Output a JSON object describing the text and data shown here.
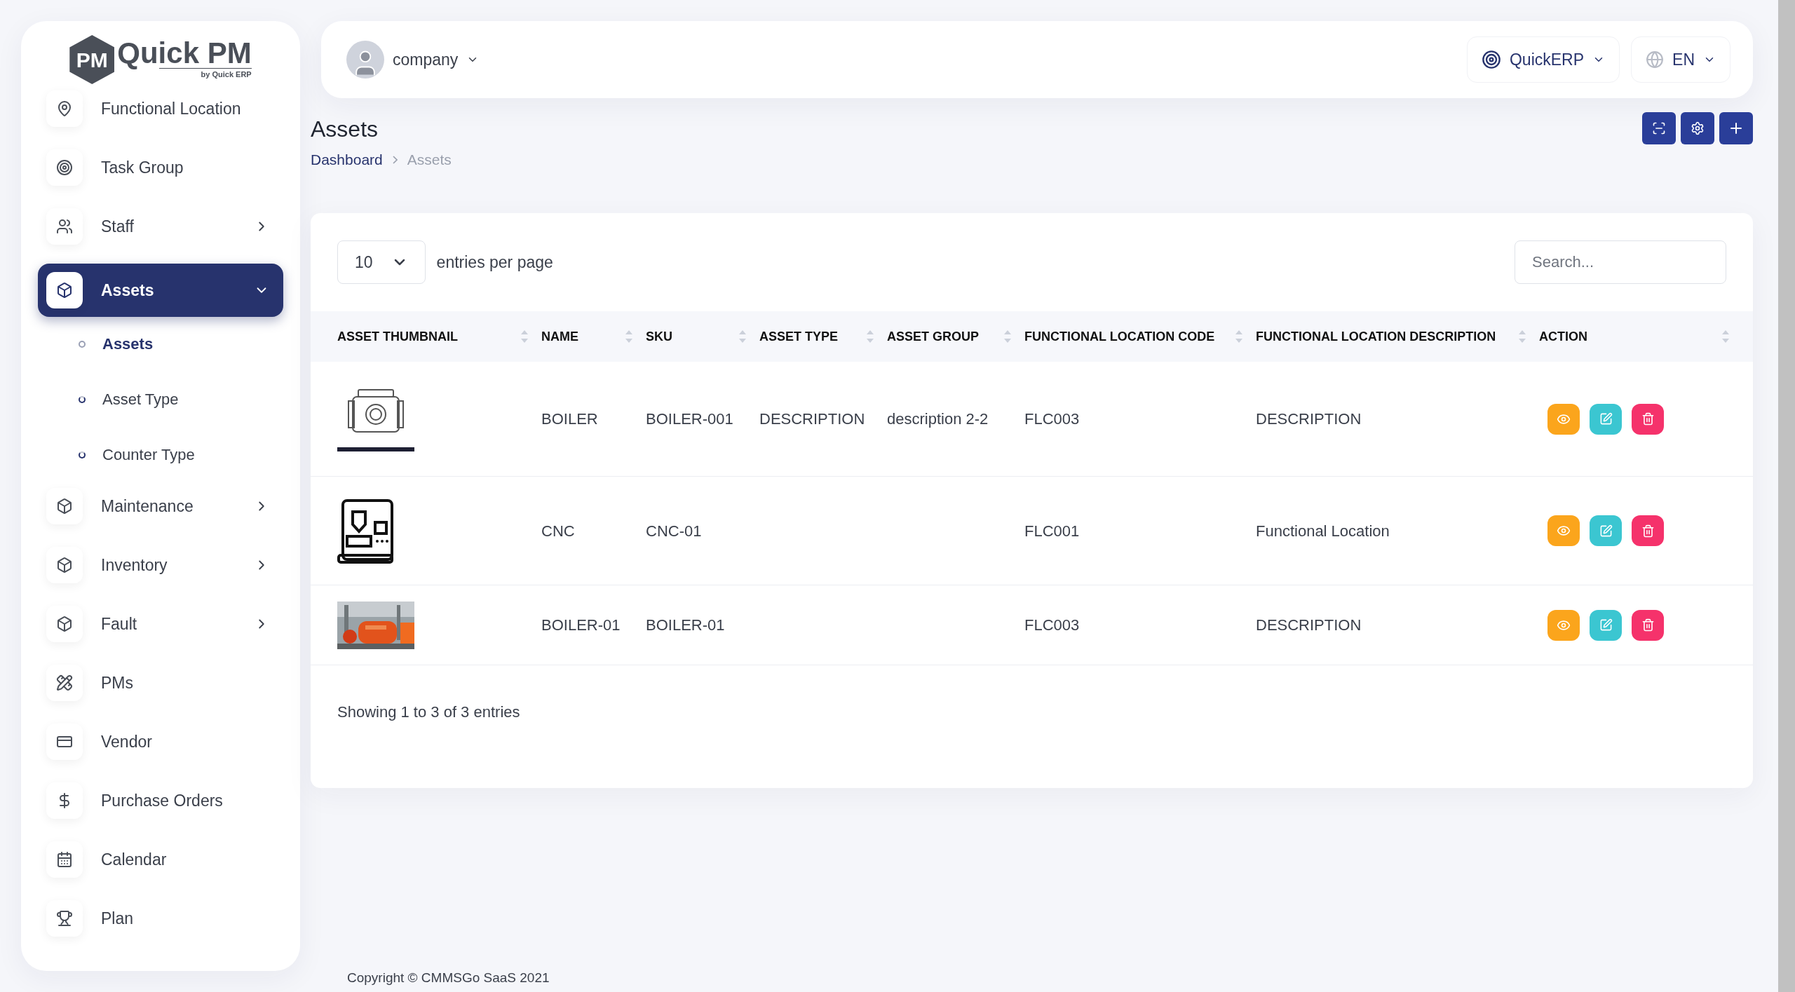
{
  "logo": {
    "badge": "PM",
    "name": "Quick PM",
    "tagline": "by Quick ERP"
  },
  "sidebar": {
    "items": [
      {
        "label": "Functional Location",
        "selected": false
      },
      {
        "label": "Task Group",
        "selected": false
      },
      {
        "label": "Staff",
        "selected": false,
        "expanded": false
      },
      {
        "label": "Assets",
        "selected": true,
        "expanded": true,
        "children": [
          {
            "label": "Assets",
            "selected": true
          },
          {
            "label": "Asset Type",
            "selected": false
          },
          {
            "label": "Counter Type",
            "selected": false
          }
        ]
      },
      {
        "label": "Maintenance",
        "selected": false,
        "expanded": false
      },
      {
        "label": "Inventory",
        "selected": false,
        "expanded": false
      },
      {
        "label": "Fault",
        "selected": false,
        "expanded": false
      },
      {
        "label": "PMs",
        "selected": false
      },
      {
        "label": "Vendor",
        "selected": false
      },
      {
        "label": "Purchase Orders",
        "selected": false
      },
      {
        "label": "Calendar",
        "selected": false
      },
      {
        "label": "Plan",
        "selected": false
      }
    ]
  },
  "topbar": {
    "user": "company",
    "company_switch": "QuickERP",
    "language": "EN"
  },
  "page": {
    "title": "Assets",
    "breadcrumb": [
      "Dashboard",
      "Assets"
    ]
  },
  "table": {
    "page_size": "10",
    "page_size_label": "entries per page",
    "search_placeholder": "Search...",
    "columns": [
      "ASSET THUMBNAIL",
      "NAME",
      "SKU",
      "ASSET TYPE",
      "ASSET GROUP",
      "FUNCTIONAL LOCATION CODE",
      "FUNCTIONAL LOCATION DESCRIPTION",
      "ACTION"
    ],
    "rows": [
      {
        "cells": [
          {
            "kind": "boiler"
          },
          "BOILER",
          "BOILER-001",
          "DESCRIPTION",
          "description 2-2",
          "FLC003",
          "DESCRIPTION"
        ]
      },
      {
        "cells": [
          {
            "kind": "cnc"
          },
          "CNC",
          "CNC-01",
          "",
          "",
          "FLC001",
          "Functional Location"
        ]
      },
      {
        "cells": [
          {
            "kind": "picture"
          },
          "BOILER-01",
          "BOILER-01",
          "",
          "",
          "FLC003",
          "DESCRIPTION"
        ]
      }
    ],
    "summary": "Showing 1 to 3 of 3 entries"
  },
  "footer": "Copyright © CMMSGo SaaS 2021"
}
